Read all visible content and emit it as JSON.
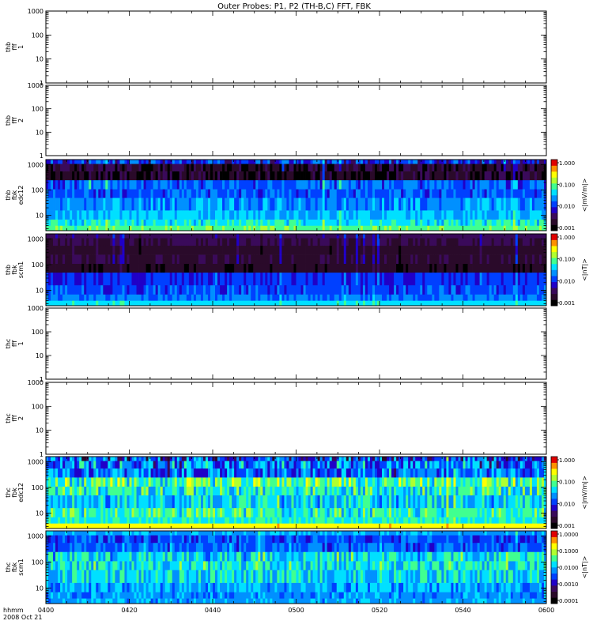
{
  "title": "Outer Probes: P1, P2 (TH-B,C) FFT, FBK",
  "time_axis": {
    "label_line1": "hhmm",
    "label_line2": "2008 Oct 21",
    "ticks": [
      "0400",
      "0420",
      "0440",
      "0500",
      "0520",
      "0540",
      "0600"
    ],
    "start_min": 240,
    "end_min": 360
  },
  "colors": {
    "scale": [
      "#000000",
      "#2a0a2a",
      "#3a0a5a",
      "#2000c8",
      "#0040ff",
      "#0090ff",
      "#00e0ff",
      "#40ff90",
      "#b0ff30",
      "#ffff00",
      "#ff9000",
      "#e00000"
    ]
  },
  "chart_data": [
    {
      "type": "heatmap",
      "name": "thb-fff1",
      "ylabel": [
        "thb",
        "fff",
        "1"
      ],
      "yscale": "log",
      "ylim": [
        1,
        1000
      ],
      "yticks": [
        "1",
        "10",
        "100",
        "1000"
      ],
      "has_data": false
    },
    {
      "type": "heatmap",
      "name": "thb-fff2",
      "ylabel": [
        "thb",
        "fff",
        "2"
      ],
      "yscale": "log",
      "ylim": [
        1,
        1000
      ],
      "yticks": [
        "1",
        "10",
        "100",
        "1000"
      ],
      "has_data": false
    },
    {
      "type": "heatmap",
      "name": "thb-fbk-edc12",
      "ylabel": [
        "thb",
        "fbk",
        "edc12"
      ],
      "yscale": "log",
      "ylim": [
        2.5,
        1600
      ],
      "yticks": [
        "10",
        "100",
        "1000"
      ],
      "has_data": true,
      "seed": 11,
      "bands": [
        {
          "fmin": 2.5,
          "fmax": 4,
          "level": 7.2,
          "var": 0.5
        },
        {
          "fmin": 4,
          "fmax": 7,
          "level": 6.2,
          "var": 0.9
        },
        {
          "fmin": 7,
          "fmax": 16,
          "level": 5.6,
          "var": 0.9
        },
        {
          "fmin": 16,
          "fmax": 50,
          "level": 4.9,
          "var": 1.0
        },
        {
          "fmin": 50,
          "fmax": 110,
          "level": 4.2,
          "var": 0.9
        },
        {
          "fmin": 110,
          "fmax": 250,
          "level": 4.4,
          "var": 1.1
        },
        {
          "fmin": 250,
          "fmax": 560,
          "level": 0.6,
          "var": 1.4
        },
        {
          "fmin": 560,
          "fmax": 1100,
          "level": 0.9,
          "var": 1.5
        },
        {
          "fmin": 1100,
          "fmax": 1600,
          "level": 3.6,
          "var": 1.6
        }
      ],
      "colorbar": {
        "label": "<|mV/m|>",
        "ticks": [
          "0.001",
          "0.010",
          "0.100",
          "1.000"
        ]
      }
    },
    {
      "type": "heatmap",
      "name": "thb-fbk-scm1",
      "ylabel": [
        "thb",
        "fbk",
        "scm1"
      ],
      "yscale": "log",
      "ylim": [
        2.5,
        1600
      ],
      "yticks": [
        "10",
        "100",
        "1000"
      ],
      "has_data": true,
      "seed": 23,
      "bands": [
        {
          "fmin": 2.5,
          "fmax": 4,
          "level": 6.2,
          "var": 0.3
        },
        {
          "fmin": 4,
          "fmax": 7,
          "level": 4.6,
          "var": 0.7
        },
        {
          "fmin": 7,
          "fmax": 16,
          "level": 4.0,
          "var": 0.8
        },
        {
          "fmin": 16,
          "fmax": 50,
          "level": 3.6,
          "var": 0.7
        },
        {
          "fmin": 50,
          "fmax": 110,
          "level": 0.8,
          "var": 0.5
        },
        {
          "fmin": 110,
          "fmax": 250,
          "level": 1.3,
          "var": 0.4
        },
        {
          "fmin": 250,
          "fmax": 560,
          "level": 0.9,
          "var": 0.4
        },
        {
          "fmin": 560,
          "fmax": 1100,
          "level": 1.5,
          "var": 0.3
        },
        {
          "fmin": 1100,
          "fmax": 1600,
          "level": 2.0,
          "var": 0.3
        }
      ],
      "colorbar": {
        "label": "<|nT|>",
        "ticks": [
          "0.001",
          "0.010",
          "0.100",
          "1.000"
        ]
      }
    },
    {
      "type": "heatmap",
      "name": "thc-fff1",
      "ylabel": [
        "thc",
        "fff",
        "1"
      ],
      "yscale": "log",
      "ylim": [
        1,
        1000
      ],
      "yticks": [
        "1",
        "10",
        "100",
        "1000"
      ],
      "has_data": false
    },
    {
      "type": "heatmap",
      "name": "thc-fff2",
      "ylabel": [
        "thc",
        "fff",
        "2"
      ],
      "yscale": "log",
      "ylim": [
        1,
        1000
      ],
      "yticks": [
        "1",
        "10",
        "100",
        "1000"
      ],
      "has_data": false
    },
    {
      "type": "heatmap",
      "name": "thc-fbk-edc12",
      "ylabel": [
        "thc",
        "fbk",
        "edc12"
      ],
      "yscale": "log",
      "ylim": [
        2.5,
        1600
      ],
      "yticks": [
        "10",
        "100",
        "1000"
      ],
      "has_data": true,
      "seed": 37,
      "bands": [
        {
          "fmin": 2.5,
          "fmax": 4,
          "level": 9.0,
          "var": 0.3
        },
        {
          "fmin": 4,
          "fmax": 7,
          "level": 6.4,
          "var": 0.9
        },
        {
          "fmin": 7,
          "fmax": 16,
          "level": 6.6,
          "var": 1.3
        },
        {
          "fmin": 16,
          "fmax": 50,
          "level": 5.8,
          "var": 1.4
        },
        {
          "fmin": 50,
          "fmax": 110,
          "level": 6.4,
          "var": 1.6
        },
        {
          "fmin": 110,
          "fmax": 250,
          "level": 7.0,
          "var": 1.8
        },
        {
          "fmin": 250,
          "fmax": 560,
          "level": 4.4,
          "var": 1.8
        },
        {
          "fmin": 560,
          "fmax": 1100,
          "level": 4.6,
          "var": 2.2
        },
        {
          "fmin": 1100,
          "fmax": 1600,
          "level": 3.8,
          "var": 2.6
        }
      ],
      "colorbar": {
        "label": "<|mV/m|>",
        "ticks": [
          "0.001",
          "0.010",
          "0.100",
          "1.000"
        ]
      }
    },
    {
      "type": "heatmap",
      "name": "thc-fbk-scm1",
      "ylabel": [
        "thc",
        "fbk",
        "scm1"
      ],
      "yscale": "log",
      "ylim": [
        2.5,
        1600
      ],
      "yticks": [
        "10",
        "100",
        "1000"
      ],
      "has_data": true,
      "seed": 53,
      "bands": [
        {
          "fmin": 2.5,
          "fmax": 4,
          "level": 5.2,
          "var": 0.8
        },
        {
          "fmin": 4,
          "fmax": 7,
          "level": 5.0,
          "var": 0.9
        },
        {
          "fmin": 7,
          "fmax": 16,
          "level": 5.3,
          "var": 1.1
        },
        {
          "fmin": 16,
          "fmax": 50,
          "level": 5.9,
          "var": 1.3
        },
        {
          "fmin": 50,
          "fmax": 110,
          "level": 6.2,
          "var": 1.4
        },
        {
          "fmin": 110,
          "fmax": 250,
          "level": 6.0,
          "var": 1.6
        },
        {
          "fmin": 250,
          "fmax": 560,
          "level": 4.4,
          "var": 1.1
        },
        {
          "fmin": 560,
          "fmax": 1100,
          "level": 4.0,
          "var": 0.9
        },
        {
          "fmin": 1100,
          "fmax": 1600,
          "level": 5.4,
          "var": 0.4
        }
      ],
      "colorbar": {
        "label": "<|nT|>",
        "ticks": [
          "0.0001",
          "0.0010",
          "0.0100",
          "0.1000",
          "1.0000"
        ]
      }
    }
  ]
}
